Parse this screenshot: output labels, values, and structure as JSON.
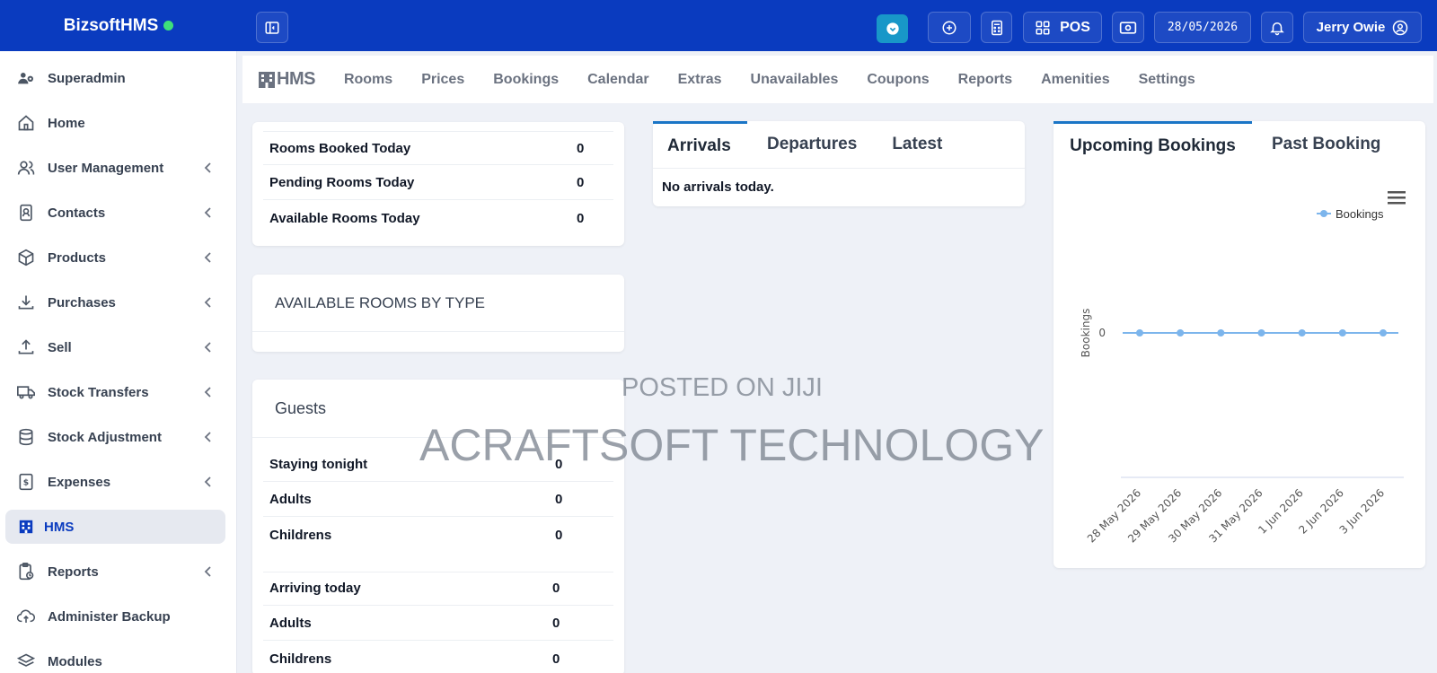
{
  "brand": {
    "name": "BizsoftHMS"
  },
  "topbar": {
    "pos_label": "POS",
    "date": "28/05/2026",
    "user": "Jerry Owie"
  },
  "sidebar": {
    "items": [
      {
        "label": "Superadmin"
      },
      {
        "label": "Home"
      },
      {
        "label": "User Management"
      },
      {
        "label": "Contacts"
      },
      {
        "label": "Products"
      },
      {
        "label": "Purchases"
      },
      {
        "label": "Sell"
      },
      {
        "label": "Stock Transfers"
      },
      {
        "label": "Stock Adjustment"
      },
      {
        "label": "Expenses"
      },
      {
        "label": "HMS"
      },
      {
        "label": "Reports"
      },
      {
        "label": "Administer Backup"
      },
      {
        "label": "Modules"
      }
    ]
  },
  "modnav": {
    "logo": "HMS",
    "links": [
      "Rooms",
      "Prices",
      "Bookings",
      "Calendar",
      "Extras",
      "Unavailables",
      "Coupons",
      "Reports",
      "Amenities",
      "Settings"
    ]
  },
  "summary": {
    "rows": [
      {
        "label": "Rooms Booked Today",
        "value": "0"
      },
      {
        "label": "Pending Rooms Today",
        "value": "0"
      },
      {
        "label": "Available Rooms Today",
        "value": "0"
      }
    ]
  },
  "available_rooms": {
    "title": "AVAILABLE ROOMS BY TYPE"
  },
  "guests": {
    "title": "Guests",
    "staying": [
      {
        "label": "Staying tonight",
        "value": "0"
      },
      {
        "label": "Adults",
        "value": "0"
      },
      {
        "label": "Childrens",
        "value": "0"
      }
    ],
    "arriving": [
      {
        "label": "Arriving today",
        "value": "0"
      },
      {
        "label": "Adults",
        "value": "0"
      },
      {
        "label": "Childrens",
        "value": "0"
      }
    ]
  },
  "arrivals_panel": {
    "tabs": [
      "Arrivals",
      "Departures",
      "Latest"
    ],
    "message": "No arrivals today."
  },
  "bookings_panel": {
    "tabs": [
      "Upcoming Bookings",
      "Past Booking"
    ]
  },
  "chart_data": {
    "type": "line",
    "title": "",
    "xlabel": "",
    "ylabel": "Bookings",
    "categories": [
      "28 May 2026",
      "29 May 2026",
      "30 May 2026",
      "31 May 2026",
      "1 Jun 2026",
      "2 Jun 2026",
      "3 Jun 2026"
    ],
    "series": [
      {
        "name": "Bookings",
        "values": [
          0,
          0,
          0,
          0,
          0,
          0,
          0
        ]
      }
    ],
    "yticks": [
      "0"
    ],
    "legend": "top-right",
    "colors": {
      "series": "#7cb5ec"
    }
  },
  "watermark": {
    "line1": "POSTED ON JIJI",
    "line2": "ACRAFTSOFT TECHNOLOGY"
  },
  "colors": {
    "topbar": "#0a3bbf",
    "accent": "#1897c8",
    "active": "#0a3bbf"
  }
}
